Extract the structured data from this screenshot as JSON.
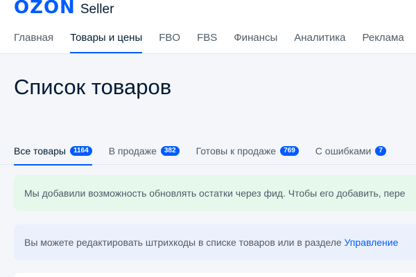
{
  "logo": {
    "mark": "OZON",
    "sub": "Seller"
  },
  "nav": {
    "items": [
      {
        "label": "Главная"
      },
      {
        "label": "Товары и цены"
      },
      {
        "label": "FBO"
      },
      {
        "label": "FBS"
      },
      {
        "label": "Финансы"
      },
      {
        "label": "Аналитика"
      },
      {
        "label": "Реклама"
      }
    ],
    "active_index": 1
  },
  "page": {
    "title": "Список товаров"
  },
  "tabs": [
    {
      "label": "Все товары",
      "count": "1164"
    },
    {
      "label": "В продаже",
      "count": "382"
    },
    {
      "label": "Готовы к продаже",
      "count": "769"
    },
    {
      "label": "С ошибками",
      "count": "7"
    }
  ],
  "banners": {
    "feed": {
      "text": "Мы добавили возможность обновлять остатки через фид. Чтобы его добавить, пере"
    },
    "barcodes": {
      "text": "Вы можете редактировать штрихкоды в списке товаров или в разделе ",
      "link": "Управление"
    }
  },
  "colors": {
    "accent": "#005bff",
    "feed_banner_bg": "#e6f7ec",
    "barcode_banner_bg": "#eaf1fc"
  }
}
